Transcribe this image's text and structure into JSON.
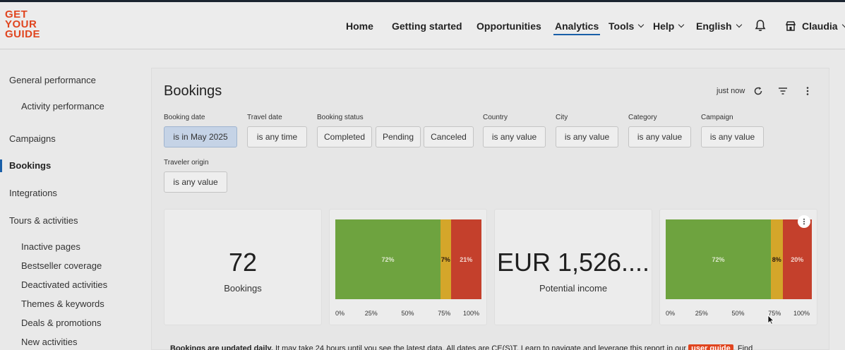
{
  "logo": {
    "lines": [
      "GET",
      "YOUR",
      "GUIDE"
    ]
  },
  "nav": {
    "items": [
      {
        "label": "Home"
      },
      {
        "label": "Getting started"
      },
      {
        "label": "Opportunities"
      },
      {
        "label": "Analytics",
        "active": true
      },
      {
        "label": "Tools"
      },
      {
        "label": "Help"
      },
      {
        "label": "English"
      }
    ],
    "user_name": "Claudia"
  },
  "sidebar": {
    "items": [
      {
        "label": "General performance"
      },
      {
        "label": "Activity performance"
      },
      {
        "label": "Campaigns"
      },
      {
        "label": "Bookings",
        "active": true
      },
      {
        "label": "Integrations"
      },
      {
        "label": "Tours & activities"
      },
      {
        "label": "Inactive pages"
      },
      {
        "label": "Bestseller coverage"
      },
      {
        "label": "Deactivated activities"
      },
      {
        "label": "Themes & keywords"
      },
      {
        "label": "Deals & promotions"
      },
      {
        "label": "New activities"
      }
    ]
  },
  "panel": {
    "title": "Bookings",
    "last_refresh": "just now",
    "filters": {
      "booking_date": {
        "label": "Booking date",
        "value": "is in May 2025"
      },
      "travel_date": {
        "label": "Travel date",
        "value": "is any time"
      },
      "booking_status": {
        "label": "Booking status",
        "options": [
          "Completed",
          "Pending",
          "Canceled"
        ]
      },
      "country": {
        "label": "Country",
        "value": "is any value"
      },
      "city": {
        "label": "City",
        "value": "is any value"
      },
      "category": {
        "label": "Category",
        "value": "is any value"
      },
      "campaign": {
        "label": "Campaign",
        "value": "is any value"
      },
      "traveler_origin": {
        "label": "Traveler origin",
        "value": "is any value"
      }
    },
    "cards": {
      "bookings": {
        "value": "72",
        "caption": "Bookings"
      },
      "bookings_bar": {
        "segments": [
          {
            "label": "72%",
            "value": 72,
            "color": "#6ea33f"
          },
          {
            "label": "7%",
            "value": 7,
            "color": "#d4a62a"
          },
          {
            "label": "21%",
            "value": 21,
            "color": "#c4402c"
          }
        ],
        "ticks": [
          "0%",
          "25%",
          "50%",
          "75%",
          "100%"
        ]
      },
      "income": {
        "value": "EUR 1,526....",
        "caption": "Potential income"
      },
      "income_bar": {
        "segments": [
          {
            "label": "72%",
            "value": 72,
            "color": "#6ea33f"
          },
          {
            "label": "8%",
            "value": 8,
            "color": "#d4a62a"
          },
          {
            "label": "20%",
            "value": 20,
            "color": "#c4402c"
          }
        ],
        "ticks": [
          "0%",
          "25%",
          "50%",
          "75%",
          "100%"
        ]
      }
    },
    "footer": {
      "bold": "Bookings are updated daily.",
      "text": " It may take 24 hours until you see the latest data. All dates are CE(S)T. Learn to navigate and leverage this report in our ",
      "link": "user guide",
      "tail": ". Find"
    }
  },
  "colors": {
    "accent": "#1a5fa8",
    "brand": "#e0451f"
  }
}
